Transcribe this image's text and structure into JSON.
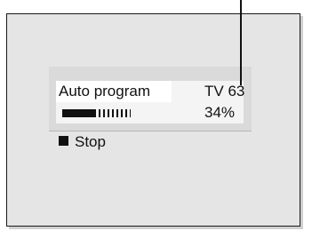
{
  "menu": {
    "title": "Auto program",
    "channel": "TV 63",
    "progress_percent_text": "34%",
    "progress_fraction": 0.34,
    "stop_label": "Stop"
  },
  "icons": {
    "stop": "stop-square-icon"
  },
  "colors": {
    "screen_background": "#e5e5e5",
    "panel_background": "#dadada",
    "highlight_background": "#ffffff",
    "text": "#111111"
  }
}
